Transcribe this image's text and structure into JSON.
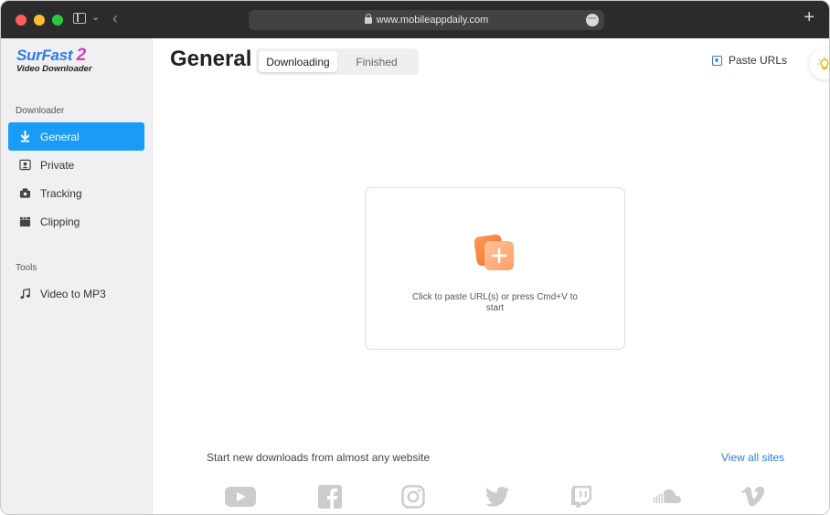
{
  "browser": {
    "url": "www.mobileappdaily.com"
  },
  "sidebar": {
    "logo": {
      "name": "SurFast",
      "version": "2",
      "subtitle": "Video Downloader"
    },
    "sections": [
      {
        "label": "Downloader",
        "items": [
          {
            "label": "General",
            "icon": "download-arrow-icon",
            "active": true
          },
          {
            "label": "Private",
            "icon": "private-user-icon",
            "active": false
          },
          {
            "label": "Tracking",
            "icon": "tracking-camera-icon",
            "active": false
          },
          {
            "label": "Clipping",
            "icon": "clapper-icon",
            "active": false
          }
        ]
      },
      {
        "label": "Tools",
        "items": [
          {
            "label": "Video to MP3",
            "icon": "music-note-icon",
            "active": false
          }
        ]
      }
    ]
  },
  "main": {
    "title": "General",
    "tabs": [
      {
        "label": "Downloading",
        "selected": true
      },
      {
        "label": "Finished",
        "selected": false
      }
    ],
    "paste_urls_label": "Paste URLs",
    "dropzone": {
      "text": "Click to paste URL(s) or press Cmd+V to start",
      "icon": "paste-plus-icon"
    },
    "footer": {
      "start_text": "Start new downloads from almost any website",
      "view_all_label": "View all sites"
    },
    "sites": [
      "YouTube",
      "Facebook",
      "Instagram",
      "Twitter",
      "Twitch",
      "SoundCloud",
      "Vimeo"
    ]
  },
  "colors": {
    "accent": "#1a9bf5",
    "link": "#2b7de9",
    "drop_icon": "#f58a4b"
  }
}
